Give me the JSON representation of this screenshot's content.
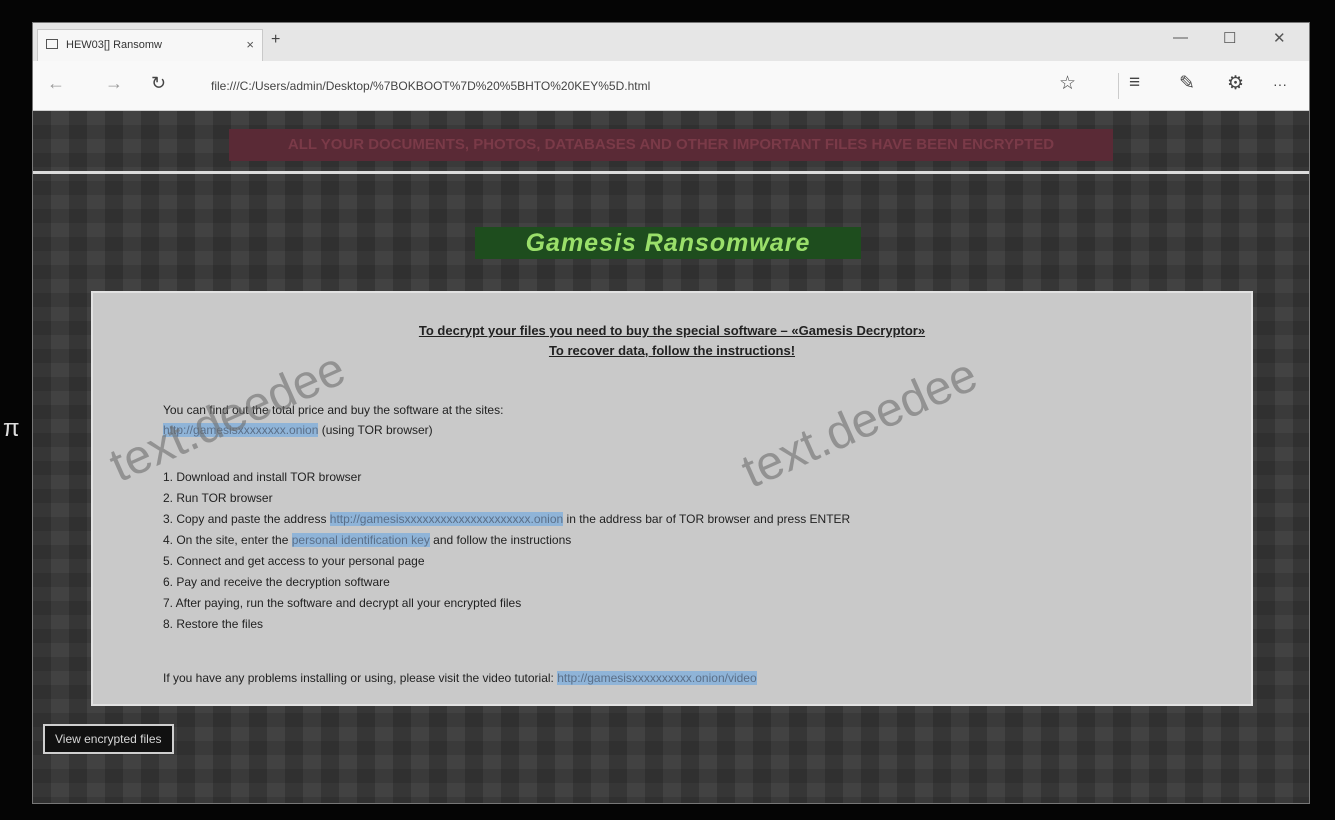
{
  "browser": {
    "tab_title": "HEW03[] Ransomw",
    "tab_close": "×",
    "new_tab": "+",
    "window_controls": [
      "—",
      "☐",
      "✕"
    ],
    "nav": {
      "back": "←",
      "forward": "→",
      "refresh": "↻"
    },
    "address": "file:///C:/Users/admin/Desktop/%7BOKBOOT%7D%20%5BHTO%20KEY%5D.html",
    "toolbar_icons": [
      "☆",
      "≡",
      "✎",
      "⚙",
      "···"
    ]
  },
  "page": {
    "banner": "ALL YOUR DOCUMENTS, PHOTOS, DATABASES AND OTHER IMPORTANT FILES HAVE BEEN ENCRYPTED",
    "title": "Gamesis Ransomware",
    "heading_1": "To decrypt your files you need to buy the special software – «Gamesis Decryptor»",
    "heading_2": "To recover data, follow the instructions!",
    "intro_line_1": "You can find out the total price and buy the software at the sites:",
    "intro_link": "http://gamesisxxxxxxxx.onion",
    "intro_suffix": " (using TOR browser)",
    "steps": [
      {
        "text": "1. Download and install TOR browser",
        "link": "",
        "suffix": ""
      },
      {
        "text": "2. Run TOR browser",
        "link": "",
        "suffix": ""
      },
      {
        "text": "3. Copy and paste the address ",
        "link": "http://gamesisxxxxxxxxxxxxxxxxxxxxx.onion",
        "suffix": " in the address bar of TOR browser and press ENTER"
      },
      {
        "text": "4. On the site, enter the ",
        "link": "personal identification key",
        "suffix": " and follow the instructions"
      },
      {
        "text": "5. Connect and get access to your personal page",
        "link": "",
        "suffix": ""
      },
      {
        "text": "6. Pay and receive the decryption software",
        "link": "",
        "suffix": ""
      },
      {
        "text": "7. After paying, run the software and decrypt all your encrypted files",
        "link": "",
        "suffix": ""
      },
      {
        "text": "8. Restore the files",
        "link": "",
        "suffix": ""
      }
    ],
    "footer_text": "If you have any problems installing or using, please visit the video tutorial: ",
    "footer_link": "http://gamesisxxxxxxxxxx.onion/video",
    "file_button": "View encrypted files",
    "watermarks": [
      "text.deedee",
      "text.deedee"
    ],
    "left_mark": "π"
  },
  "colors": {
    "title_bg": "#1e4d1e",
    "title_fg": "#9adf6a",
    "banner_bg": "#5a2a36",
    "panel_bg": "#c9c9c9",
    "link_highlight": "#8fb4d8"
  }
}
